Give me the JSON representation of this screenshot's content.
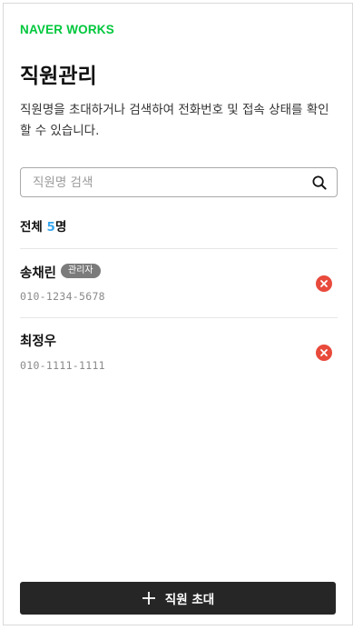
{
  "brand": {
    "logo_text": "NAVER WORKS",
    "color": "#00c73c"
  },
  "page": {
    "title": "직원관리",
    "description": "직원명을 초대하거나 검색하여 전화번호 및 접속 상태를 확인할 수 있습니다."
  },
  "search": {
    "placeholder": "직원명 검색",
    "value": "",
    "icon": "search-icon"
  },
  "summary": {
    "label": "전체",
    "count": "5",
    "unit": "명",
    "count_color": "#3aa8f0"
  },
  "employees": [
    {
      "name": "송채린",
      "badge": "관리자",
      "phone": "010-1234-5678",
      "action_icon": "remove-icon"
    },
    {
      "name": "최정우",
      "badge": "",
      "phone": "010-1111-1111",
      "action_icon": "remove-icon"
    }
  ],
  "invite_button": {
    "label": "직원 초대",
    "icon": "plus-icon"
  },
  "colors": {
    "remove": "#e84a3c",
    "button_bg": "#262626",
    "badge_bg": "#7b7b7b"
  }
}
